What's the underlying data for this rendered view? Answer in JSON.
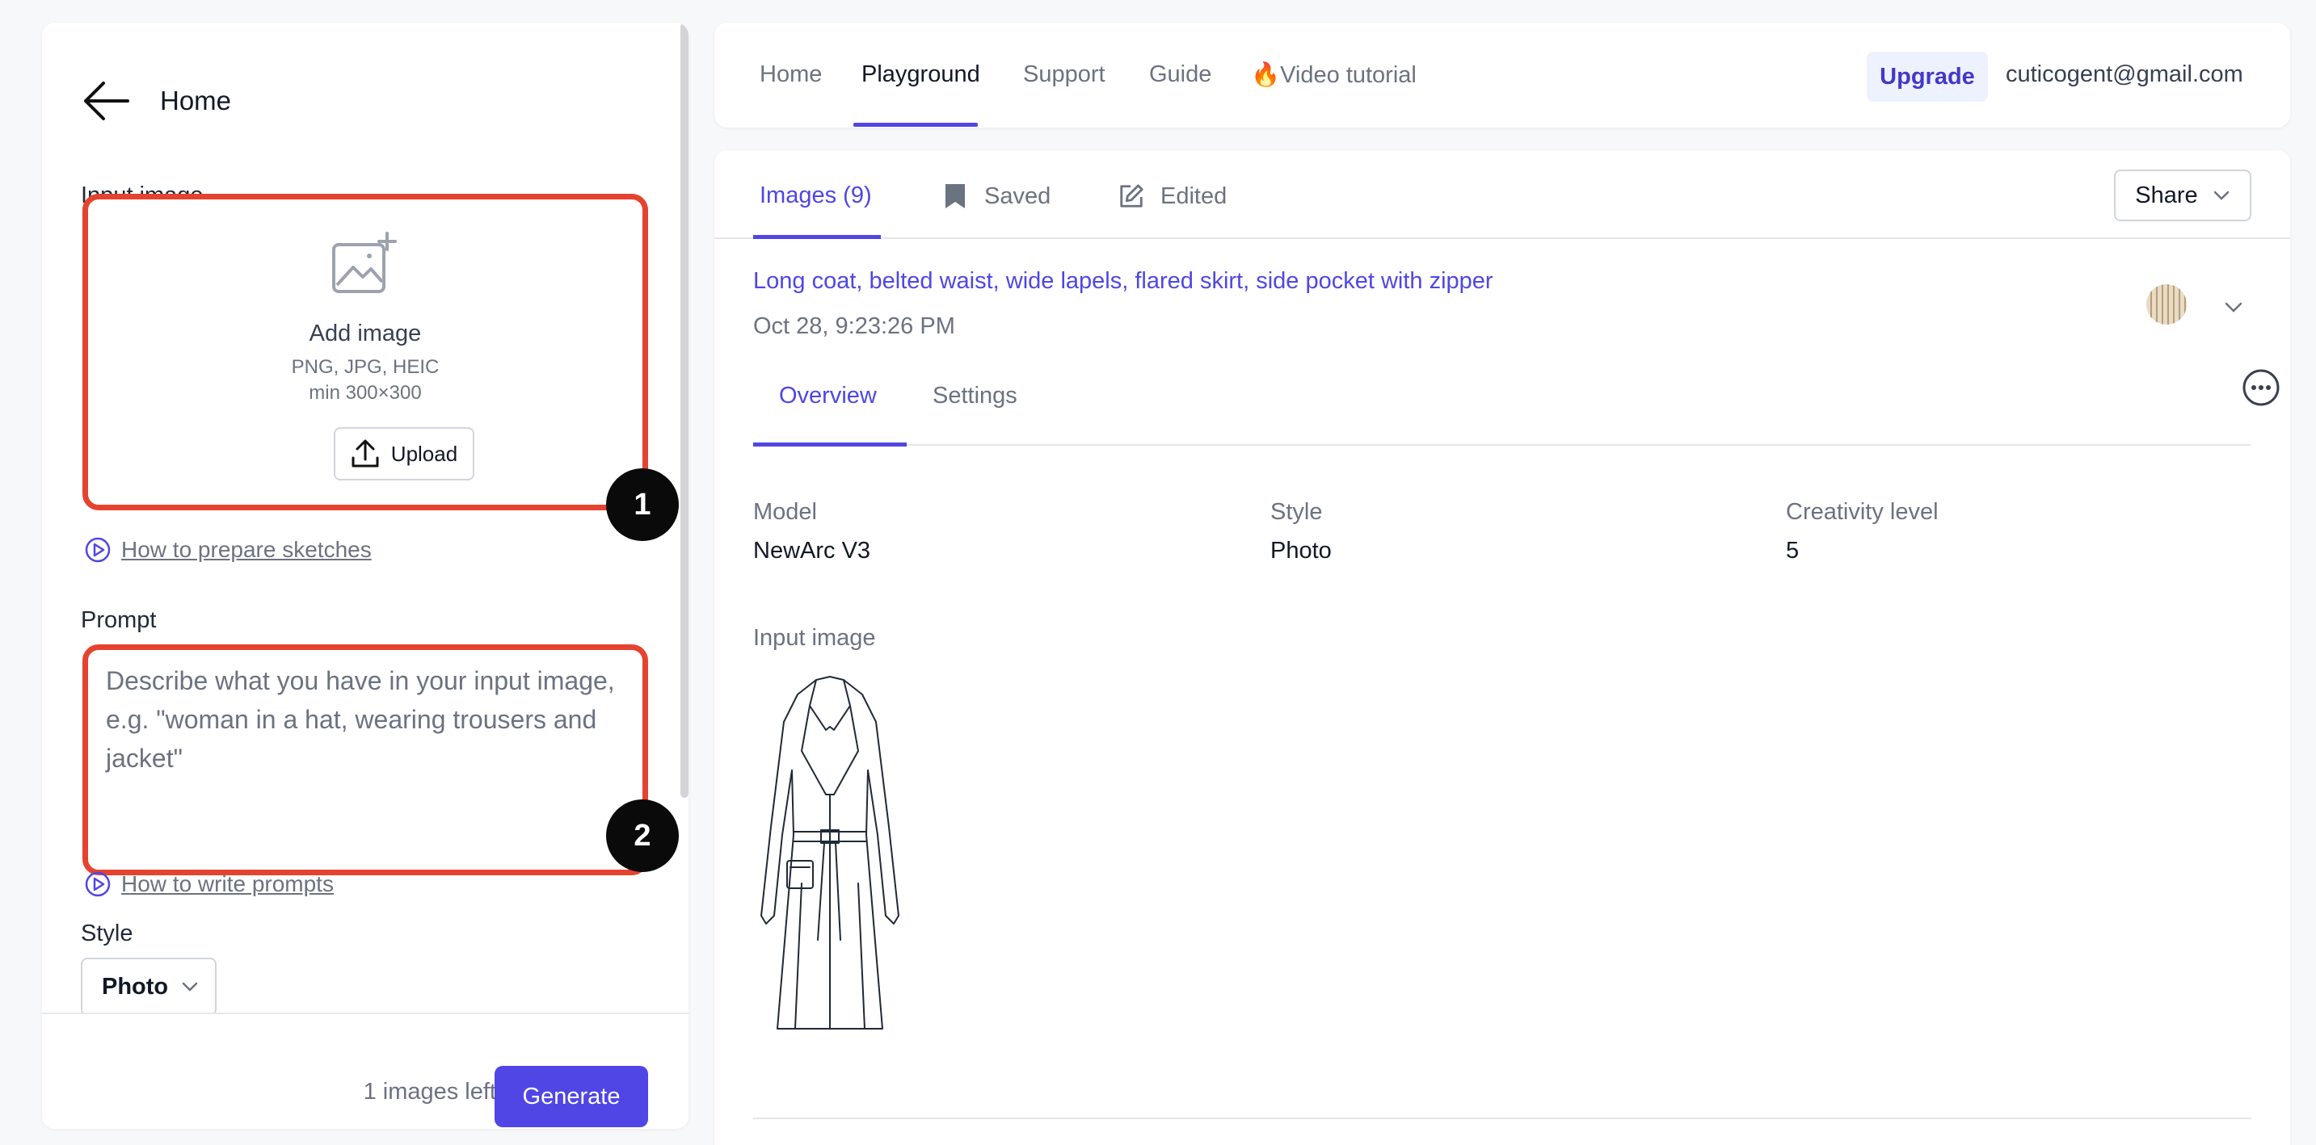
{
  "left_panel": {
    "back_label": "Home",
    "input_image_label": "Input image",
    "dropzone": {
      "title": "Add image",
      "formats": "PNG, JPG, HEIC",
      "min_size": "min 300×300",
      "upload_label": "Upload",
      "icon": "image-add-icon"
    },
    "badge1": "1",
    "badge2": "2",
    "sketch_link": "How to prepare sketches",
    "prompt_label": "Prompt",
    "prompt_placeholder": "Describe what you have in your input image, e.g. \"woman in a hat, wearing trousers and jacket\"",
    "prompt_value": "",
    "prompt_link": "How to write prompts",
    "style_label": "Style",
    "style_value": "Photo",
    "images_left": "1 images left",
    "generate_label": "Generate"
  },
  "top_nav": {
    "links": [
      "Home",
      "Playground",
      "Support",
      "Guide",
      "🔥Video tutorial"
    ],
    "active": "Playground",
    "upgrade_label": "Upgrade",
    "user_email": "cuticogent@gmail.com"
  },
  "main": {
    "tabs": [
      "Images (9)",
      "Saved",
      "Edited"
    ],
    "share_label": "Share",
    "result_title": "Long coat, belted waist, wide lapels, flared skirt, side pocket with zipper",
    "result_date": "Oct 28, 9:23:26 PM",
    "subtabs": [
      "Overview",
      "Settings"
    ],
    "meta": {
      "model_label": "Model",
      "model_value": "NewArc V3",
      "style_label": "Style",
      "style_value": "Photo",
      "creativity_label": "Creativity level",
      "creativity_value": "5"
    },
    "input_image_label": "Input image"
  },
  "colors": {
    "accent": "#4f46e5",
    "highlight": "#e5432f",
    "badge": "#0a0a0a"
  }
}
